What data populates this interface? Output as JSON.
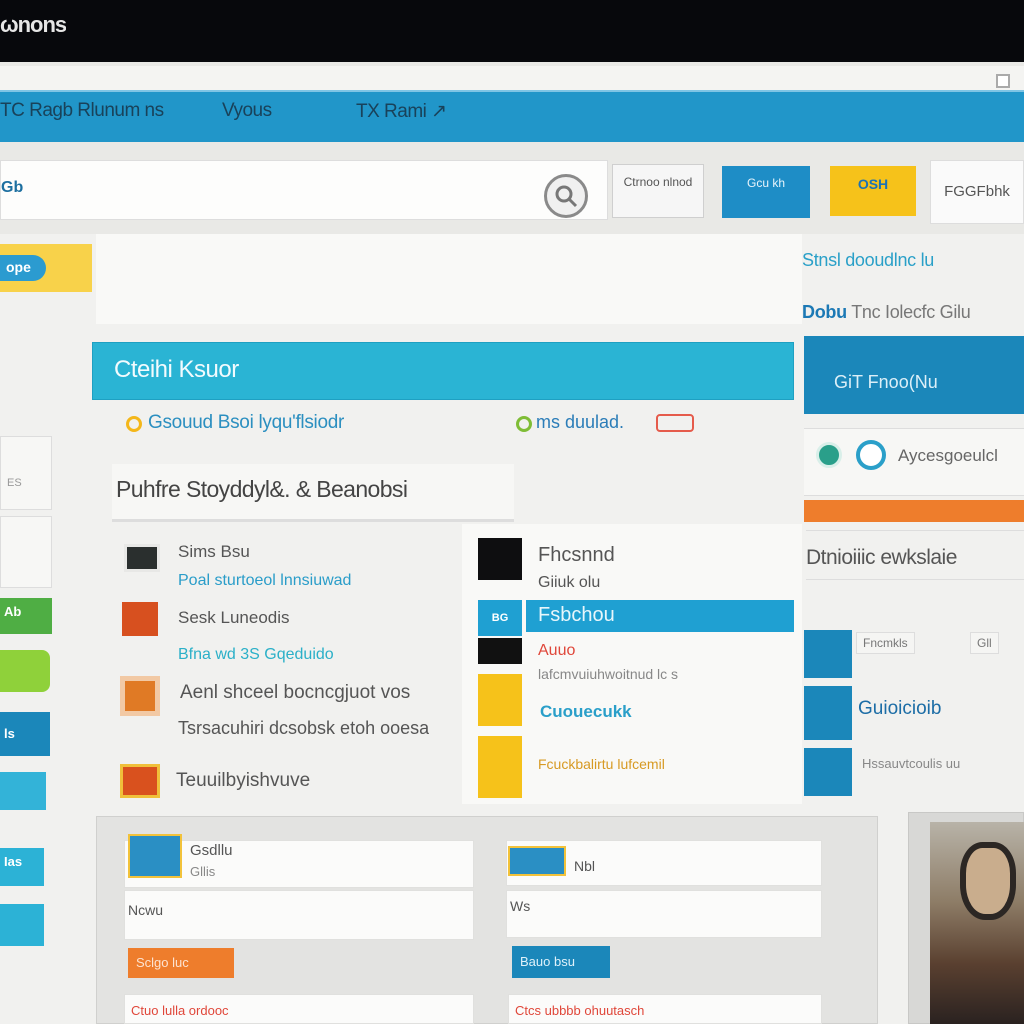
{
  "window": {
    "title": "ωnons"
  },
  "tabs": [
    "TC Ragb Rlunum ns",
    "Vyous",
    "TX Rami ↗"
  ],
  "toolbar": {
    "url": "Gb",
    "button_a": "Ctrnoo nlnod",
    "button_b": "Gcu kh",
    "button_c": "OSH",
    "button_d": "FGGFbhk"
  },
  "left": {
    "badge": "ope",
    "card_label": "ES",
    "chip_green": "Ab",
    "chip_blue": "ls",
    "chip_cyan": "Ias"
  },
  "main": {
    "header": "Cteihi Ksuor",
    "sub1": "Gsouud Bsoi lyqu'flsiodr",
    "sub2": "ms duulad.",
    "list_title": "Puhfre Stoyddyl&. & Beanobsi",
    "rows": [
      {
        "title": "Sims Bsu",
        "sub": "Poal sturtoeol lnnsiuwad"
      },
      {
        "title": "Sesk Luneodis",
        "sub": "Bfna wd 3S Gqeduido"
      },
      {
        "title": "Aenl shceel bocncgjuot vos",
        "sub": "Tsrsacuhiri dcsobsk etoh ooesa"
      },
      {
        "title": "Teuuilbyishvuve",
        "sub": ""
      }
    ],
    "mid": {
      "item1": "Fhcsnnd",
      "item1_sub": "Giiuk olu",
      "badge": "BG",
      "cyan_label": "Fsbchou",
      "red_label": "Auuo",
      "red_sub": "lafcmvuiuhwoitnud lc s",
      "yellow_label": "Cuouecukk",
      "yellow_sub": "Fcuckbalirtu lufcemil"
    }
  },
  "rail": {
    "line1": "Stnsl dooudlnc lu",
    "line2_bold": "Dobu",
    "line2": "Tnc Iolecfc Gilu",
    "head": "GiT Fnoo(Nu",
    "tab_label": "Aycesgoeulcl",
    "heading2": "Dtnioiiic ewkslaie",
    "chip1": "Fncmkls",
    "chip2": "Gll",
    "row2": "Guioicioib",
    "row3": "Hssauvtcoulis uu"
  },
  "bottom": {
    "card1_title": "Gsdllu",
    "card1_sub": "Gllis",
    "card1_label": "Ncwu",
    "card1_button": "Sclgo luc",
    "card1_footer": "Ctuo lulla ordooc",
    "card2_title": "Nbl",
    "card2_label": "Ws",
    "card2_button": "Bauo bsu",
    "card2_footer": "Ctcs ubbbb ohuutasch"
  },
  "colors": {
    "accent_blue": "#2196c9",
    "accent_cyan": "#2ab4d4",
    "accent_yellow": "#f6c21a",
    "accent_orange": "#ee7d2c"
  }
}
